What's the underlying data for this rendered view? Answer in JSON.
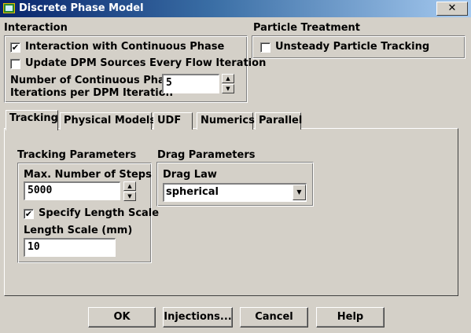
{
  "window": {
    "title": "Discrete Phase Model",
    "close_glyph": "✕"
  },
  "interaction": {
    "heading": "Interaction",
    "interaction_continuous": {
      "label": "Interaction with Continuous Phase",
      "checked": true
    },
    "update_dpm_sources": {
      "label": "Update DPM Sources Every Flow Iteration",
      "checked": false
    },
    "iterations_label_line1": "Number of Continuous Phase",
    "iterations_label_line2": "Iterations per DPM Iteration",
    "iterations_value": "5"
  },
  "particle_treatment": {
    "heading": "Particle Treatment",
    "unsteady_tracking": {
      "label": "Unsteady Particle Tracking",
      "checked": false
    }
  },
  "tabs": [
    {
      "label": "Tracking",
      "active": true
    },
    {
      "label": "Physical Models",
      "active": false
    },
    {
      "label": "UDF",
      "active": false
    },
    {
      "label": "Numerics",
      "active": false
    },
    {
      "label": "Parallel",
      "active": false
    }
  ],
  "tracking": {
    "heading": "Tracking Parameters",
    "max_steps_label": "Max. Number of Steps",
    "max_steps_value": "5000",
    "specify_length_scale": {
      "label": "Specify Length Scale",
      "checked": true
    },
    "length_scale_label": "Length Scale (mm)",
    "length_scale_value": "10"
  },
  "drag": {
    "heading": "Drag Parameters",
    "law_label": "Drag Law",
    "law_value": "spherical"
  },
  "buttons": {
    "ok": "OK",
    "injections": "Injections...",
    "cancel": "Cancel",
    "help": "Help"
  },
  "icons": {
    "check_glyph": "✔",
    "spin_up": "▲",
    "spin_down": "▼",
    "dropdown": "▼"
  },
  "colors": {
    "title_bar_start": "#08246b",
    "title_bar_end": "#a6caf0",
    "dialog_face": "#d4d0c8"
  }
}
